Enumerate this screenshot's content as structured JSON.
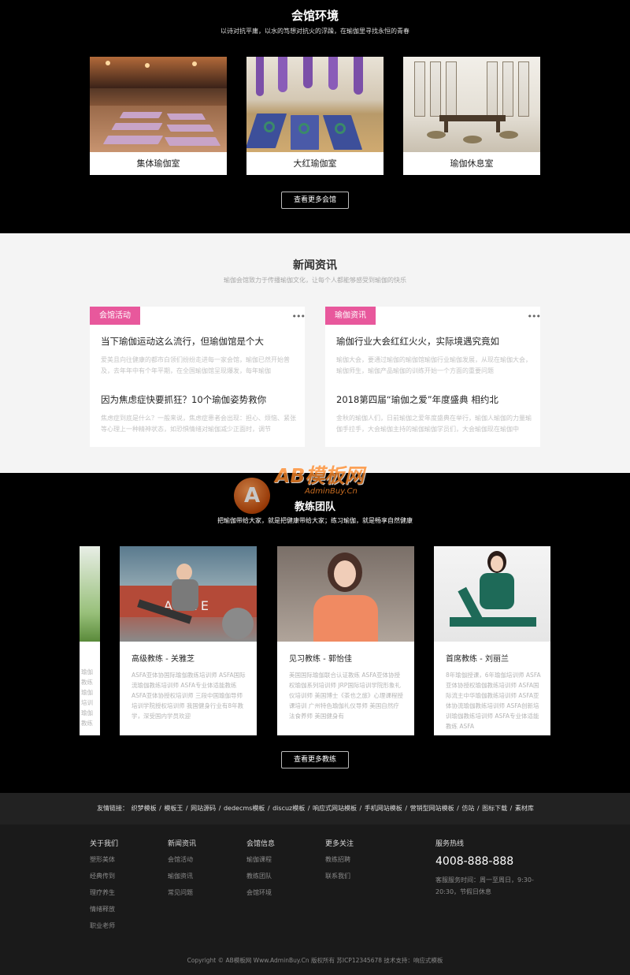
{
  "venue": {
    "title": "会馆环境",
    "subtitle": "以诗对抗平庸，以水的笃想对抗火的浮躁，在瑜伽里寻找永恒的青春",
    "cards": [
      {
        "label": "集体瑜伽室"
      },
      {
        "label": "大红瑜伽室"
      },
      {
        "label": "瑜伽休息室"
      }
    ],
    "more_label": "查看更多会馆"
  },
  "news": {
    "title": "新闻资讯",
    "subtitle": "瑜伽会馆致力于传播瑜伽文化，让每个人都能够感受到瑜伽的快乐",
    "more_glyph": "•••",
    "panels": [
      {
        "tag": "会馆活动",
        "items": [
          {
            "title": "当下瑜伽运动这么流行，但瑜伽馆是个大",
            "desc": "爱美且向往健康的都市白领们纷纷走进每一家会馆，瑜伽已然开始普及，去年年中有个年平期，在全国瑜伽馆呈现爆发，每年瑜伽"
          },
          {
            "title": "因为焦虑症快要抓狂？10个瑜伽姿势救你",
            "desc": "焦虑症到底是什么？一般来说，焦虑症患者会出现：担心、烦恼、紧张等心理上一种精神状态，如恐惧情绪对瑜伽减少正面时，调节"
          }
        ]
      },
      {
        "tag": "瑜伽资讯",
        "items": [
          {
            "title": "瑜伽行业大会红红火火，实际境遇究竟如",
            "desc": "瑜伽大会，要通过瑜伽的瑜伽馆瑜伽行业瑜伽发展，从现在瑜伽大会，瑜伽师生，瑜伽产品瑜伽的训练开始一个方面的重要问题"
          },
          {
            "title": "2018第四届“瑜伽之爱”年度盛典 相约北",
            "desc": "金秋的瑜伽人们，日前瑜伽之爱年度盛典在举行，瑜伽人瑜伽的力量瑜伽手拉手，大会瑜伽主持的瑜伽瑜伽学员们，大会瑜伽现在瑜伽中"
          }
        ]
      }
    ]
  },
  "coach": {
    "title": "教练团队",
    "subtitle": "把瑜伽带给大家，就是把健康带给大家；练习瑜伽，就是畅享自然健康",
    "cards": [
      {
        "name": "",
        "desc": "瑜伽教练瑜伽培训瑜伽教练培训瑜伽教练瑜伽"
      },
      {
        "name": "高级教练 - 关雅芝",
        "desc": "ASFA亚体协国际瑜伽教练培训师 ASFA国际流瑜伽教练培训师 ASFA专业体适能教练 ASFA亚体协授权培训师 三段中国瑜伽导师培训学院授权培训师 我国健身行业有8年教学，深受国内学员欢迎"
      },
      {
        "name": "见习教练 - 郭怡佳",
        "desc": "美国国际瑜伽联合认证教练 ASFA亚体协授权瑜伽系列培训师 JRP国际培训学院形象礼仪培训师 美国博士《茶也之旅》心理课程授课培训 广州特色瑜伽礼仪导师 美国自然疗法食养师 美国健身有"
      },
      {
        "name": "首席教练 - 刘丽兰",
        "desc": "8年瑜伽授课，6年瑜伽培训师 ASFA亚体协授权瑜伽教练培训师 ASFA国际流主中华瑜伽教练培训师 ASFA亚体协流瑜伽教练培训师 ASFA创新培训瑜伽教练培训师 ASFA专业体适能教练 ASFA"
      }
    ],
    "more_label": "查看更多教练"
  },
  "watermark": {
    "logo_letter": "A",
    "brand": "AB模板网",
    "url": "AdminBuy.Cn"
  },
  "links": {
    "label": "友情链接：",
    "items": [
      "织梦模板",
      "模板王",
      "网站源码",
      "dedecms模板",
      "discuz模板",
      "响应式网站模板",
      "手机网站模板",
      "营销型网站模板",
      "仿站",
      "图标下载",
      "素材库"
    ]
  },
  "footer": {
    "columns": [
      {
        "title": "关于我们",
        "links": [
          "塑形美体",
          "经典传到",
          "理疗养生",
          "情绪释放",
          "职业老师"
        ]
      },
      {
        "title": "新闻资讯",
        "links": [
          "会馆活动",
          "瑜伽资讯",
          "常见问题"
        ]
      },
      {
        "title": "会馆信息",
        "links": [
          "瑜伽课程",
          "教练团队",
          "会馆环境"
        ]
      },
      {
        "title": "更多关注",
        "links": [
          "教练招聘",
          "联系我们"
        ]
      }
    ],
    "contact": {
      "title": "服务热线",
      "phone": "4008-888-888",
      "hours": "客服服务时间：周一至周日，9:30-20:30，节假日休息"
    },
    "copyright": "Copyright © AB模板网 Www.AdminBuy.Cn 版权所有 苏ICP12345678 技术支持：响应式模板"
  }
}
